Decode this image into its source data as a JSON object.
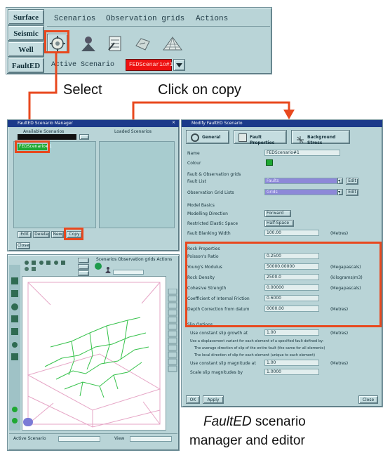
{
  "top": {
    "side_tabs": [
      "Surface",
      "Seismic",
      "Well",
      "FaultED"
    ],
    "menus": [
      "Scenarios",
      "Observation grids",
      "Actions"
    ],
    "active_scenario_label": "Active Scenario",
    "active_scenario_value": "FEDScenario#1"
  },
  "captions": {
    "select": "Select",
    "click_copy": "Click on copy",
    "footer_line1_italic": "FaultED",
    "footer_line1_rest": " scenario",
    "footer_line2": "manager and editor"
  },
  "manager": {
    "title": "FaultED Scenario Manager",
    "left_header": "Available Scenarios",
    "right_header": "Loaded Scenarios",
    "selected_item": "FEDScenario#1",
    "bottom_buttons": [
      "Edit",
      "Delete",
      "New",
      "Copy"
    ],
    "close_label": "Close"
  },
  "editor": {
    "title": "Modify FaultED Scenario",
    "tabs": [
      "General",
      "Fault Properties",
      "Background Stress"
    ],
    "name_label": "Name",
    "name_value": "FEDScenario#1",
    "colour_label": "Colour",
    "section_fault": "Fault & Observation grids",
    "fault_list_label": "Fault List",
    "fault_list_value": "Faults",
    "obs_grid_label": "Observation Grid Lists",
    "obs_grid_value": "Grids",
    "edit_label": "Edit",
    "section_model": "Model Basics",
    "modelling_label": "Modelling Direction",
    "modelling_value": "Forward",
    "elastic_label": "Restricted Elastic Space",
    "elastic_value": "Half-Space",
    "blanking_label": "Fault Blanking Width",
    "blanking_value": "100.00",
    "blanking_unit": "(Metres)",
    "section_rock": "Rock Properties",
    "rock_rows": [
      {
        "label": "Poisson's Ratio",
        "value": "0.2500",
        "unit": ""
      },
      {
        "label": "Young's Modulus",
        "value": "50000.00000",
        "unit": "(Megapascals)"
      },
      {
        "label": "Rock Density",
        "value": "2500.0",
        "unit": "(kilograms/m3)"
      },
      {
        "label": "Cohesive Strength",
        "value": "0.00000",
        "unit": "(Megapascals)"
      },
      {
        "label": "Coefficient of Internal Friction",
        "value": "0.6000",
        "unit": ""
      },
      {
        "label": "Depth Correction from datum",
        "value": "0000.00",
        "unit": "(Metres)"
      }
    ],
    "section_slip": "Slip Options",
    "slip_rows": [
      "Use constant slip growth at",
      "Use a displacement variant for each element of a specified fault defined by:",
      "The average direction of slip of the entire fault (the same for all elements)",
      "The local direction of slip for each element (unique to each element)",
      "Use constant slip magnitude at",
      "Scale slip magnitudes by"
    ],
    "slip_value_1": "1.00",
    "slip_unit_1": "(Metres)",
    "slip_value_2": "1.00",
    "slip_unit_2": "(Metres)",
    "slip_scale": "1.0000",
    "ok_label": "OK",
    "apply_label": "Apply",
    "close_label": "Close"
  },
  "viewer": {
    "tabs": [
      "Surface",
      "Seismic",
      "Well",
      "FaultED"
    ],
    "menus": "Scenarios  Observation grids  Actions",
    "status_left": "Active Scenario",
    "status_right": "View"
  },
  "colors": {
    "highlight": "#e8481e",
    "panel": "#b9d4d7",
    "fault_lines": "#36c24b",
    "scenario_red": "#ee1111"
  }
}
